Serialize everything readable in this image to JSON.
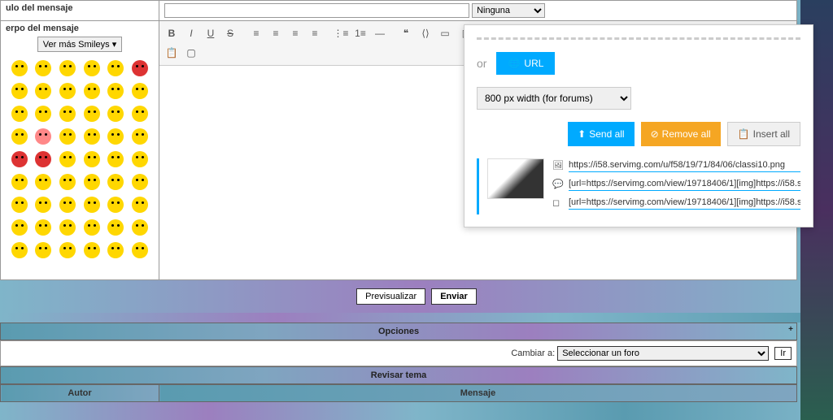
{
  "labels": {
    "title": "ulo del mensaje",
    "body": "erpo del mensaje"
  },
  "title_select": "Ninguna",
  "smiley_button": "Ver más Smileys",
  "popup": {
    "or": "or",
    "url_btn": "URL",
    "width_option": "800 px width (for forums)",
    "send_all": "Send all",
    "remove_all": "Remove all",
    "insert_all": "Insert all",
    "url1": "https://i58.servimg.com/u/f58/19/71/84/06/classi10.png",
    "url2": "[url=https://servimg.com/view/19718406/1][img]https://i58.servimg",
    "url3": "[url=https://servimg.com/view/19718406/1][img]https://i58.servimg"
  },
  "buttons": {
    "preview": "Previsualizar",
    "send": "Enviar"
  },
  "sections": {
    "options": "Opciones",
    "change_to": "Cambiar a:",
    "select_forum": "Seleccionar un foro",
    "go": "Ir",
    "review": "Revisar tema",
    "author": "Autor",
    "message": "Mensaje"
  }
}
